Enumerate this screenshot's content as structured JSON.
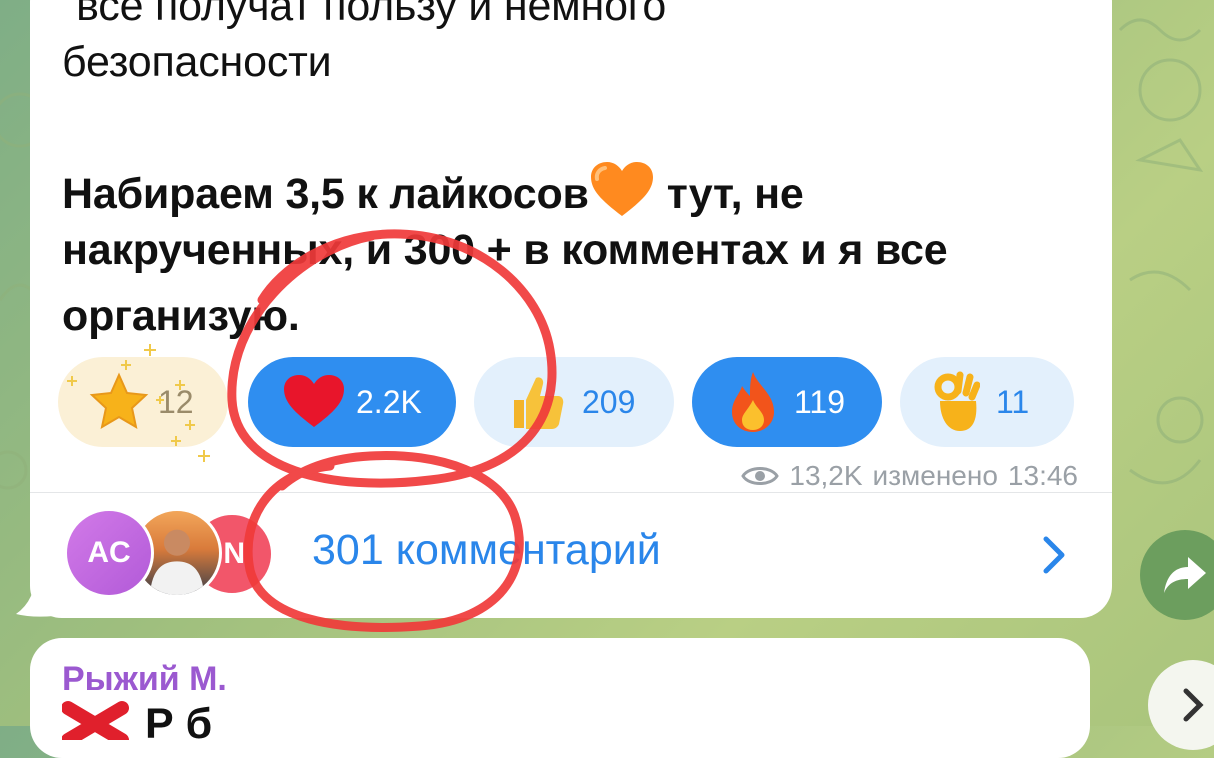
{
  "message": {
    "line_top_partial": "“все получат пользу и немного",
    "line_top": "безопасности",
    "bold_line_1a": "Набираем 3,5 к лайкосов",
    "bold_line_1_emoji": "orange-heart",
    "bold_line_1b": "тут, не",
    "bold_line_2": "накрученных, и 300 + в комментах и я все",
    "bold_line_3": "организую."
  },
  "reactions": [
    {
      "emoji": "star-icon",
      "count": "12",
      "style": "gold"
    },
    {
      "emoji": "red-heart-icon",
      "count": "2.2K",
      "style": "blue"
    },
    {
      "emoji": "thumbs-up-icon",
      "count": "209",
      "style": "light"
    },
    {
      "emoji": "fire-icon",
      "count": "119",
      "style": "blue"
    },
    {
      "emoji": "ok-hand-icon",
      "count": "11",
      "style": "light"
    }
  ],
  "meta": {
    "views": "13,2K",
    "edited_label": "изменено",
    "time": "13:46"
  },
  "comments": {
    "avatar_initials": "AC",
    "avatar_third_initial": "N",
    "label": "301 комментарий"
  },
  "next_message": {
    "sender": "Рыжий М.",
    "text_partial": "Р б"
  },
  "colors": {
    "accent_blue": "#2f8ef0",
    "link_blue": "#2a86ea",
    "sender_purple": "#9b59d0",
    "annotation_red": "#f03a3a"
  }
}
